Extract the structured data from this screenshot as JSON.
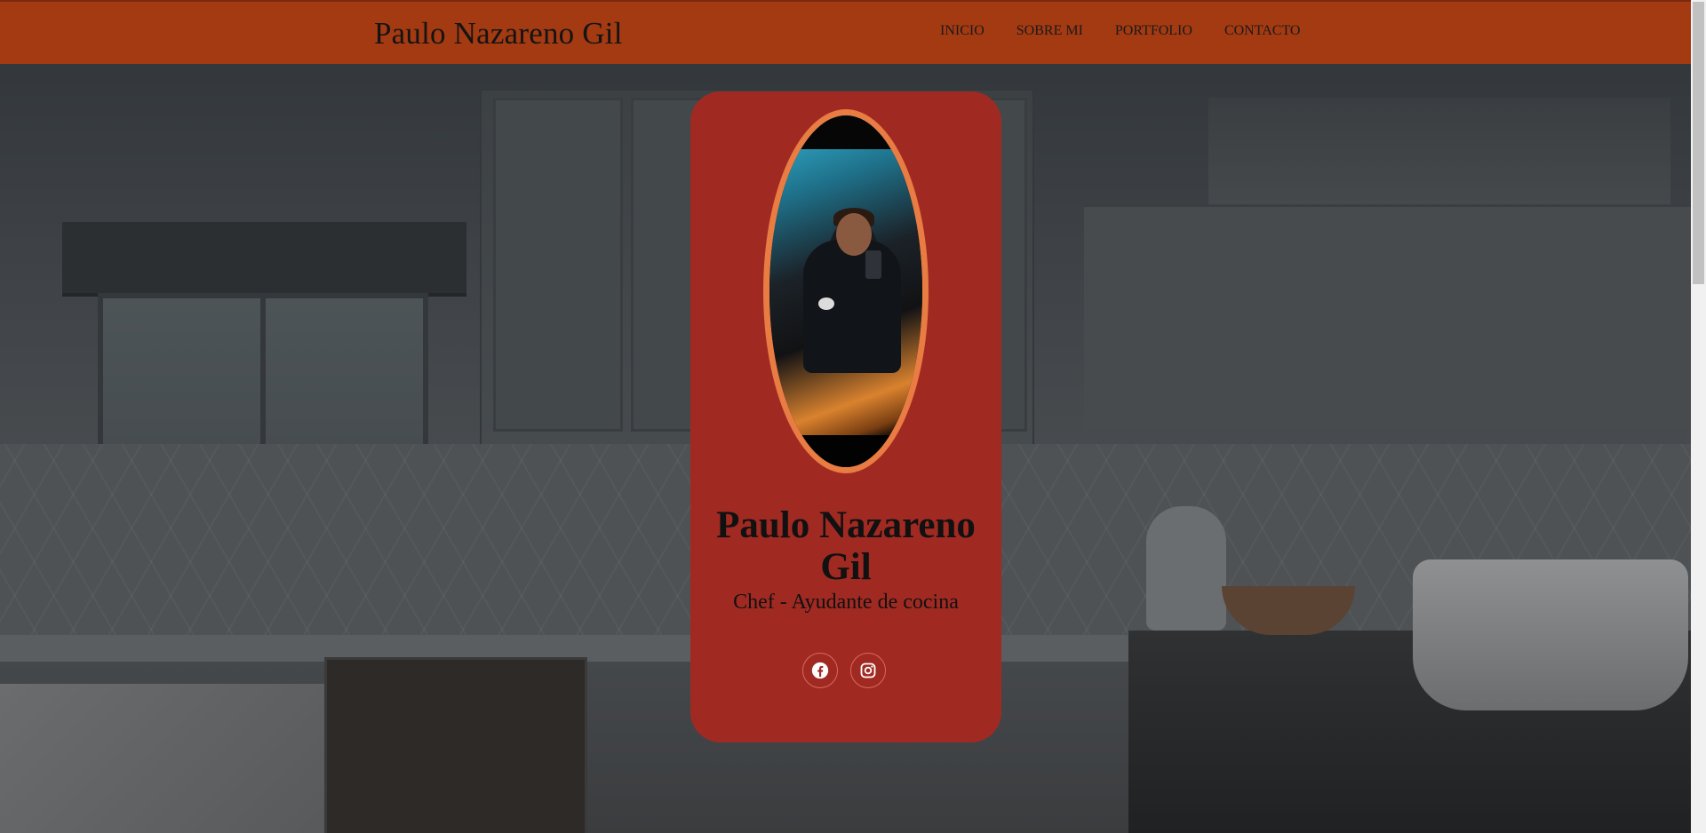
{
  "header": {
    "brand": "Paulo Nazareno Gil",
    "nav": [
      "INICIO",
      "SOBRE MI",
      "PORTFOLIO",
      "CONTACTO"
    ]
  },
  "card": {
    "name": "Paulo Nazareno Gil",
    "role": "Chef - Ayudante de cocina",
    "socials": [
      {
        "icon": "facebook-icon"
      },
      {
        "icon": "instagram-icon"
      }
    ]
  },
  "colors": {
    "header": "#a33a12",
    "card": "#a02a22",
    "photo_border": "#e97c42",
    "text": "#111111"
  }
}
